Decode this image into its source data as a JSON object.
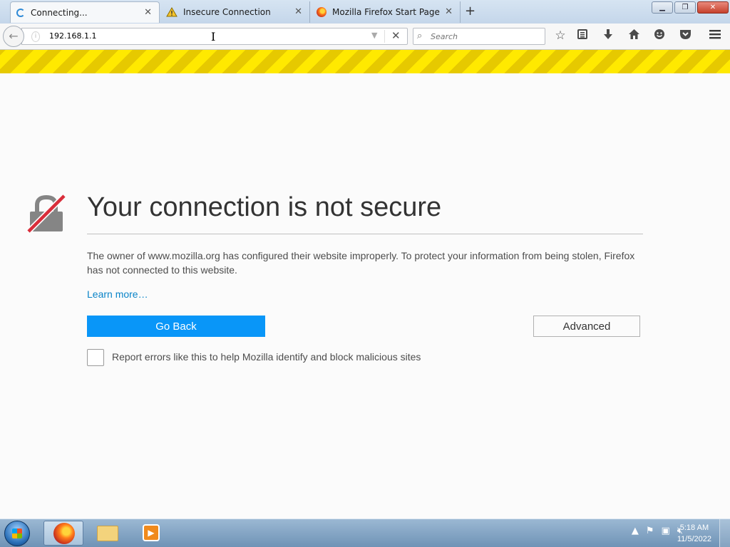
{
  "tabs": [
    {
      "label": "Connecting...",
      "icon": "loading-spinner-icon",
      "active": true
    },
    {
      "label": "Insecure Connection",
      "icon": "warning-icon",
      "active": false
    },
    {
      "label": "Mozilla Firefox Start Page",
      "icon": "firefox-icon",
      "active": false
    }
  ],
  "tab_close_glyph": "✕",
  "new_tab_glyph": "+",
  "window_controls": {
    "minimize": "▁",
    "maximize": "❐",
    "close": "✕"
  },
  "toolbar": {
    "url": "192.168.1.1",
    "search_placeholder": "Search",
    "icons": [
      "bookmark-star-icon",
      "reading-list-icon",
      "download-icon",
      "home-icon",
      "hello-icon",
      "pocket-icon",
      "menu-icon"
    ]
  },
  "error_page": {
    "title": "Your connection is not secure",
    "description": "The owner of www.mozilla.org has configured their website improperly. To protect your information from being stolen, Firefox has not connected to this website.",
    "learn_more": "Learn more…",
    "go_back": "Go Back",
    "advanced": "Advanced",
    "report_label": "Report errors like this to help Mozilla identify and block malicious sites",
    "report_checked": false
  },
  "taskbar": {
    "apps": [
      "firefox",
      "windows-explorer",
      "media-player"
    ],
    "time": "5:18 AM",
    "date": "11/5/2022"
  },
  "colors": {
    "warning_stripe": "#ffe900",
    "primary_button": "#0996f8",
    "link": "#0a84c8"
  }
}
